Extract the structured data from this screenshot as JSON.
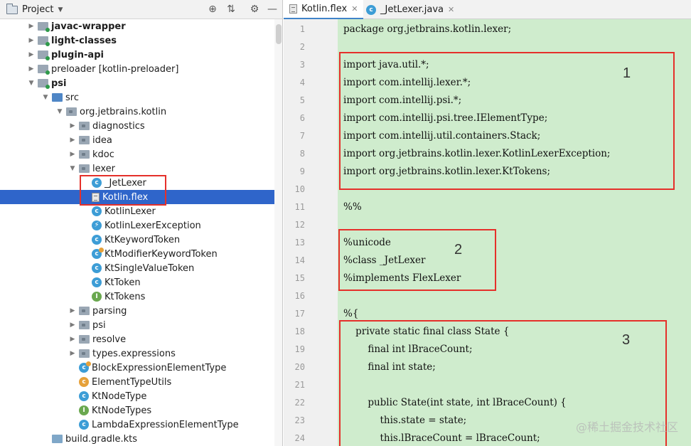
{
  "project_panel": {
    "title": "Project",
    "tree": [
      {
        "label": "javac-wrapper",
        "bold": true,
        "icon": "module-icon",
        "arrow": "right",
        "indent": 0
      },
      {
        "label": "light-classes",
        "bold": true,
        "icon": "module-icon",
        "arrow": "right",
        "indent": 0
      },
      {
        "label": "plugin-api",
        "bold": true,
        "icon": "module-icon",
        "arrow": "right",
        "indent": 0
      },
      {
        "label": "preloader [kotlin-preloader]",
        "bold": false,
        "icon": "module-icon",
        "arrow": "right",
        "indent": 0
      },
      {
        "label": "psi",
        "bold": true,
        "icon": "module-icon",
        "arrow": "down",
        "indent": 0
      },
      {
        "label": "src",
        "bold": false,
        "icon": "source-folder-icon",
        "arrow": "down",
        "indent": 1
      },
      {
        "label": "org.jetbrains.kotlin",
        "bold": false,
        "icon": "package-icon",
        "arrow": "down",
        "indent": 2
      },
      {
        "label": "diagnostics",
        "bold": false,
        "icon": "package-icon",
        "arrow": "right",
        "indent": 3
      },
      {
        "label": "idea",
        "bold": false,
        "icon": "package-icon",
        "arrow": "right",
        "indent": 3
      },
      {
        "label": "kdoc",
        "bold": false,
        "icon": "package-icon",
        "arrow": "right",
        "indent": 3
      },
      {
        "label": "lexer",
        "bold": false,
        "icon": "package-icon",
        "arrow": "down",
        "indent": 3
      },
      {
        "label": "_JetLexer",
        "bold": false,
        "icon": "class-icon",
        "arrow": "",
        "indent": 4
      },
      {
        "label": "Kotlin.flex",
        "bold": false,
        "icon": "flex-file-icon",
        "arrow": "",
        "indent": 4,
        "selected": true
      },
      {
        "label": "KotlinLexer",
        "bold": false,
        "icon": "class-icon",
        "arrow": "",
        "indent": 4
      },
      {
        "label": "KotlinLexerException",
        "bold": false,
        "icon": "exception-class-icon",
        "arrow": "",
        "indent": 4
      },
      {
        "label": "KtKeywordToken",
        "bold": false,
        "icon": "class-icon",
        "arrow": "",
        "indent": 4
      },
      {
        "label": "KtModifierKeywordToken",
        "bold": false,
        "icon": "class-kotlin-icon",
        "arrow": "",
        "indent": 4
      },
      {
        "label": "KtSingleValueToken",
        "bold": false,
        "icon": "class-icon",
        "arrow": "",
        "indent": 4
      },
      {
        "label": "KtToken",
        "bold": false,
        "icon": "class-icon",
        "arrow": "",
        "indent": 4
      },
      {
        "label": "KtTokens",
        "bold": false,
        "icon": "interface-icon",
        "arrow": "",
        "indent": 4
      },
      {
        "label": "parsing",
        "bold": false,
        "icon": "package-icon",
        "arrow": "right",
        "indent": 3
      },
      {
        "label": "psi",
        "bold": false,
        "icon": "package-icon",
        "arrow": "right",
        "indent": 3
      },
      {
        "label": "resolve",
        "bold": false,
        "icon": "package-icon",
        "arrow": "right",
        "indent": 3
      },
      {
        "label": "types.expressions",
        "bold": false,
        "icon": "package-icon",
        "arrow": "right",
        "indent": 3
      },
      {
        "label": "BlockExpressionElementType",
        "bold": false,
        "icon": "class-kotlin-icon",
        "arrow": "",
        "indent": 3
      },
      {
        "label": "ElementTypeUtils",
        "bold": false,
        "icon": "kotlin-file-icon",
        "arrow": "",
        "indent": 3
      },
      {
        "label": "KtNodeType",
        "bold": false,
        "icon": "class-icon",
        "arrow": "",
        "indent": 3
      },
      {
        "label": "KtNodeTypes",
        "bold": false,
        "icon": "interface-icon",
        "arrow": "",
        "indent": 3
      },
      {
        "label": "LambdaExpressionElementType",
        "bold": false,
        "icon": "class-icon",
        "arrow": "",
        "indent": 3
      },
      {
        "label": "build.gradle.kts",
        "bold": false,
        "icon": "gradle-file-icon",
        "arrow": "",
        "indent": 1
      }
    ]
  },
  "editor": {
    "tabs": [
      {
        "label": "Kotlin.flex",
        "active": true,
        "icon": "flex-file-icon"
      },
      {
        "label": "_JetLexer.java",
        "active": false,
        "icon": "class-icon"
      }
    ],
    "lines": [
      {
        "n": "1",
        "text": "package org.jetbrains.kotlin.lexer;"
      },
      {
        "n": "2",
        "text": ""
      },
      {
        "n": "3",
        "text": "import java.util.*;"
      },
      {
        "n": "4",
        "text": "import com.intellij.lexer.*;"
      },
      {
        "n": "5",
        "text": "import com.intellij.psi.*;"
      },
      {
        "n": "6",
        "text": "import com.intellij.psi.tree.IElementType;"
      },
      {
        "n": "7",
        "text": "import com.intellij.util.containers.Stack;"
      },
      {
        "n": "8",
        "text": "import org.jetbrains.kotlin.lexer.KotlinLexerException;"
      },
      {
        "n": "9",
        "text": "import org.jetbrains.kotlin.lexer.KtTokens;"
      },
      {
        "n": "10",
        "text": ""
      },
      {
        "n": "11",
        "text": "%%"
      },
      {
        "n": "12",
        "text": ""
      },
      {
        "n": "13",
        "text": "%unicode"
      },
      {
        "n": "14",
        "text": "%class _JetLexer"
      },
      {
        "n": "15",
        "text": "%implements FlexLexer"
      },
      {
        "n": "16",
        "text": ""
      },
      {
        "n": "17",
        "text": "%{"
      },
      {
        "n": "18",
        "text": "    private static final class State {"
      },
      {
        "n": "19",
        "text": "        final int lBraceCount;"
      },
      {
        "n": "20",
        "text": "        final int state;"
      },
      {
        "n": "21",
        "text": ""
      },
      {
        "n": "22",
        "text": "        public State(int state, int lBraceCount) {"
      },
      {
        "n": "23",
        "text": "            this.state = state;"
      },
      {
        "n": "24",
        "text": "            this.lBraceCount = lBraceCount;"
      }
    ],
    "annotations": [
      "1",
      "2",
      "3"
    ]
  },
  "watermark": "@稀土掘金技术社区",
  "colors": {
    "selection": "#2f65ca",
    "code_background": "#cfeccd",
    "annotation_red": "#e5302a",
    "active_tab_underline": "#4083c9"
  }
}
